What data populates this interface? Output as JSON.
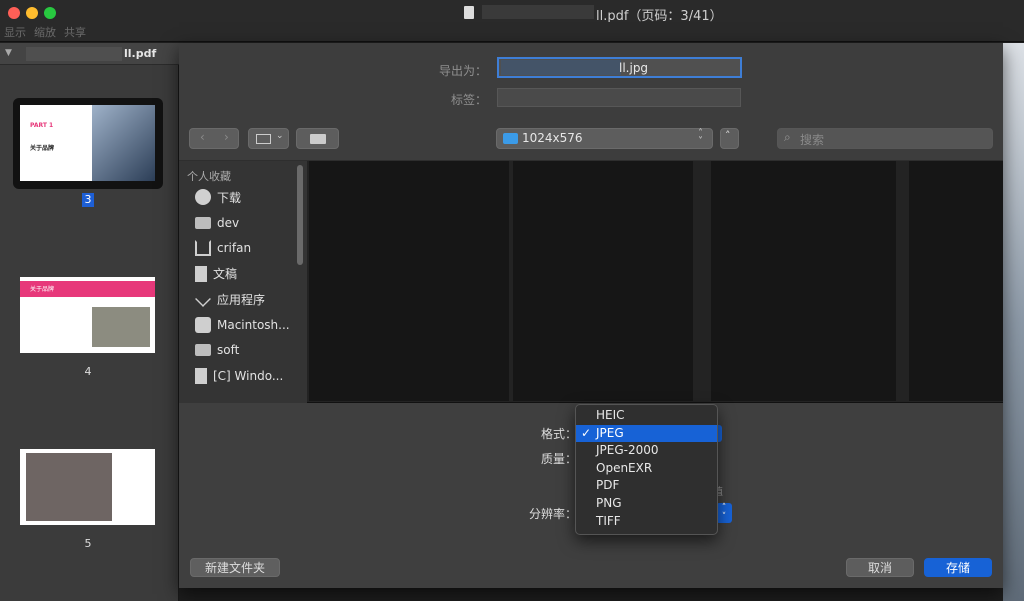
{
  "window": {
    "title": "ll.pdf（页码：3/41）"
  },
  "toolbar": {
    "items": [
      "显示",
      "缩放",
      "共享"
    ]
  },
  "sidebar": {
    "doc_name": "ll.pdf",
    "pages": [
      {
        "num": "3",
        "title1": "PART 1",
        "title2": "关于品牌"
      },
      {
        "num": "4",
        "title1": "关于品牌"
      },
      {
        "num": "5"
      }
    ]
  },
  "dialog": {
    "export_label": "导出为：",
    "export_value": "ll.jpg",
    "tags_label": "标签：",
    "location": "1024x576",
    "search_placeholder": "搜索",
    "favorites_header": "个人收藏",
    "favorites": [
      {
        "label": "下载",
        "icon": "download-icon"
      },
      {
        "label": "dev",
        "icon": "folder-icon"
      },
      {
        "label": "crifan",
        "icon": "home-icon"
      },
      {
        "label": "文稿",
        "icon": "document-icon"
      },
      {
        "label": "应用程序",
        "icon": "applications-icon"
      },
      {
        "label": "Macintosh...",
        "icon": "disk-icon"
      },
      {
        "label": "soft",
        "icon": "folder-icon"
      },
      {
        "label": "[C] Windo...",
        "icon": "file-icon"
      }
    ],
    "format_label": "格式：",
    "quality_label": "质量：",
    "resolution_label": "分辨率：",
    "side_hint": "值",
    "format_options": [
      "HEIC",
      "JPEG",
      "JPEG-2000",
      "OpenEXR",
      "PDF",
      "PNG",
      "TIFF"
    ],
    "format_selected": "JPEG",
    "new_folder_label": "新建文件夹",
    "cancel_label": "取消",
    "save_label": "存储"
  },
  "colors": {
    "accent": "#1762d6",
    "traffic": [
      "#ff5f57",
      "#febc2e",
      "#28c840"
    ]
  }
}
